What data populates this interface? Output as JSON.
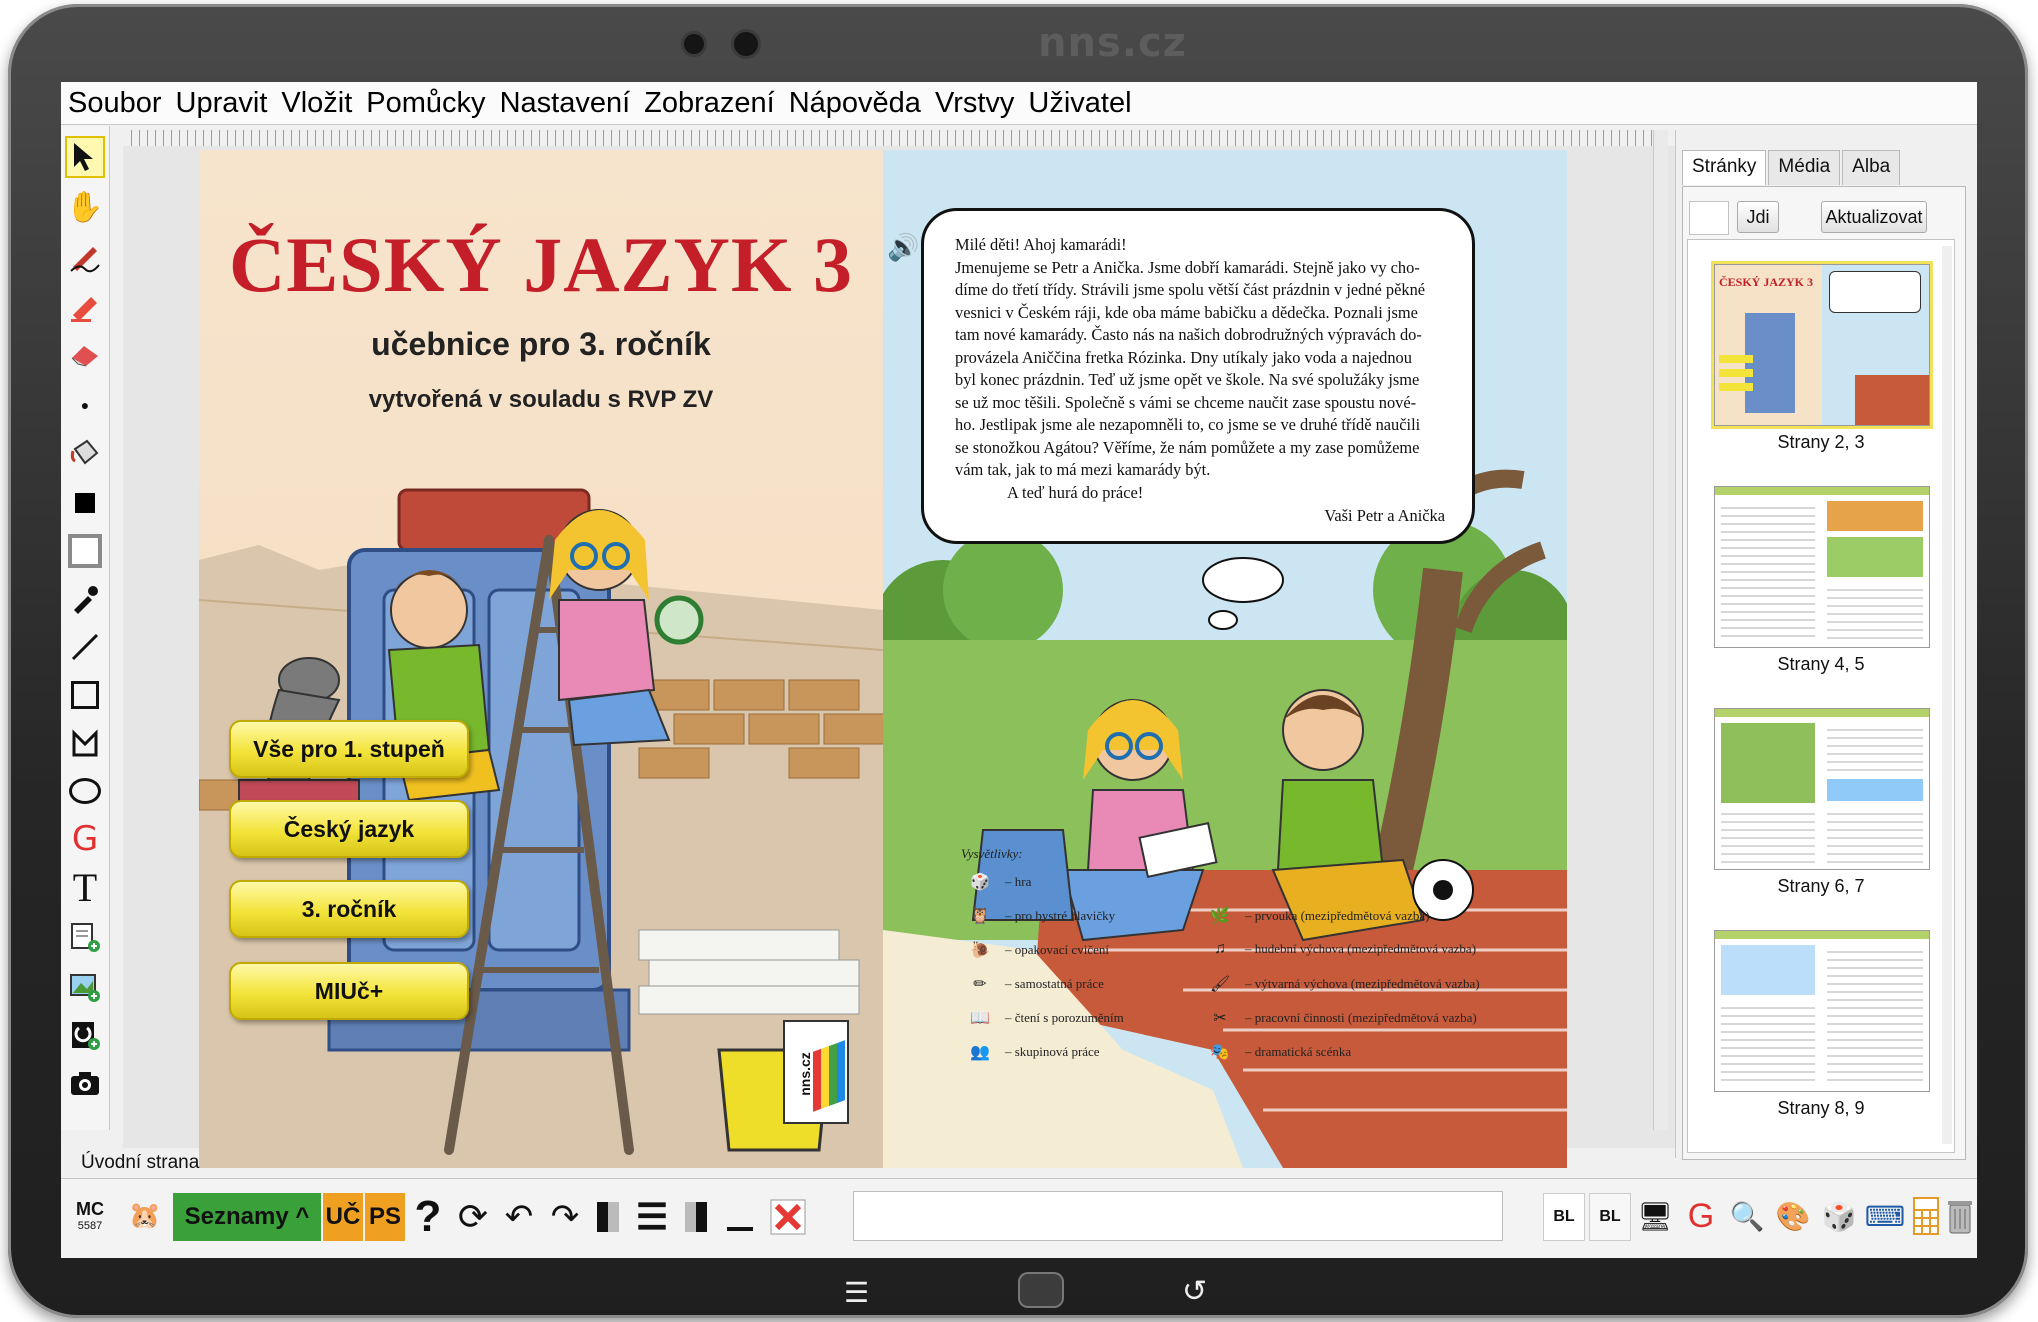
{
  "device": {
    "brand": "nns.cz"
  },
  "menu": [
    "Soubor",
    "Upravit",
    "Vložit",
    "Pomůcky",
    "Nastavení",
    "Zobrazení",
    "Nápověda",
    "Vrstvy",
    "Uživatel"
  ],
  "cover": {
    "title": "ČESKÝ JAZYK 3",
    "subtitle": "učebnice pro 3. ročník",
    "subtitle2": "vytvořená v souladu s RVP ZV",
    "buttons": [
      "Vše pro 1. stupeň",
      "Český jazyk",
      "3. ročník",
      "MIUč+"
    ],
    "logo_text": "nns.cz"
  },
  "letter": {
    "lines": [
      "Milé děti! Ahoj kamarádi!",
      "Jmenujeme se Petr a Anička. Jsme dobří kamarádi. Stejně jako vy cho-",
      "díme do třetí třídy. Strávili jsme spolu větší část prázdnin v jedné pěkné",
      "vesnici v Českém ráji, kde oba máme babičku a dědečka. Poznali jsme",
      "tam nové kamarády. Často nás na našich dobrodružných výpravách do-",
      "provázela Aniččina fretka Rózinka. Dny utíkaly jako voda a najednou",
      "byl konec prázdnin. Teď už jsme opět ve škole. Na své spolužáky jsme",
      "se už moc těšili. Společně s vámi se chceme naučit zase spoustu nové-",
      "ho. Jestlipak jsme ale nezapomněli to, co jsme se ve druhé třídě naučili",
      "se stonožkou Agátou? Věříme, že nám pomůžete a my zase pomůžeme",
      "vám tak, jak to má mezi kamarády být."
    ],
    "closing": "A teď hurá do práce!",
    "signature": "Vaši Petr a Anička"
  },
  "legend": {
    "title": "Vysvětlivky:",
    "left": [
      "– hra",
      "– pro bystré hlavičky",
      "– opakovací cvičení",
      "– samostatná práce",
      "– čtení s porozuměním",
      "– skupinová práce"
    ],
    "right": [
      "– prvouka (mezipředmětová vazba)",
      "– hudební výchova (mezipředmětová vazba)",
      "– výtvarná výchova (mezipředmětová vazba)",
      "– pracovní činnosti (mezipředmětová vazba)",
      "– dramatická scénka"
    ]
  },
  "status": {
    "page_name": "Úvodní strana"
  },
  "sidepanel": {
    "tabs": [
      "Stránky",
      "Média",
      "Alba"
    ],
    "goto_button": "Jdi",
    "refresh_button": "Aktualizovat",
    "thumbnails": [
      {
        "label": "Strany 2, 3",
        "thumb_title": "ČESKÝ JAZYK 3"
      },
      {
        "label": "Strany 4, 5"
      },
      {
        "label": "Strany 6, 7"
      },
      {
        "label": "Strany 8, 9"
      }
    ]
  },
  "bottombar": {
    "mc": "MC",
    "mc_number": "5587",
    "lists_label": "Seznamy ^",
    "uc": "UČ",
    "ps": "PS",
    "bl1": "BL",
    "bl2": "BL"
  },
  "colors": {
    "title_red": "#c41f28",
    "lists_green": "#3aa03a",
    "uc_orange": "#f0a020",
    "button_yellow": "#f3e43a"
  }
}
